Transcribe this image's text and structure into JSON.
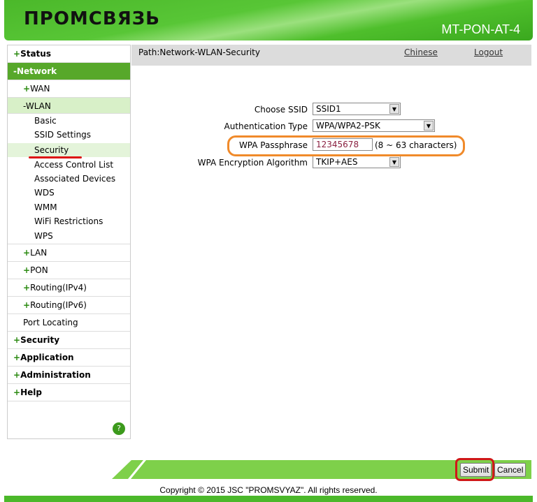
{
  "header": {
    "logo": "ПРОМСВЯЗЬ",
    "model": "MT-PON-AT-4"
  },
  "path": {
    "text": "Path:Network-WLAN-Security",
    "chinese": "Chinese",
    "logout": "Logout"
  },
  "sidebar": {
    "status": "Status",
    "network": "-Network",
    "wan": "WAN",
    "wlan": "-WLAN",
    "wlan_items": [
      "Basic",
      "SSID Settings",
      "Security",
      "Access Control List",
      "Associated Devices",
      "WDS",
      "WMM",
      "WiFi Restrictions",
      "WPS"
    ],
    "lan": "LAN",
    "pon": "PON",
    "routing4": "Routing(IPv4)",
    "routing6": "Routing(IPv6)",
    "port": "Port Locating",
    "security": "Security",
    "application": "Application",
    "administration": "Administration",
    "help": "Help",
    "plus": "+",
    "help_icon": "?"
  },
  "form": {
    "ssid_label": "Choose SSID",
    "ssid_value": "SSID1",
    "auth_label": "Authentication Type",
    "auth_value": "WPA/WPA2-PSK",
    "pass_label": "WPA Passphrase",
    "pass_value": "12345678",
    "pass_hint": "(8 ~ 63 characters)",
    "enc_label": "WPA Encryption Algorithm",
    "enc_value": "TKIP+AES"
  },
  "buttons": {
    "submit": "Submit",
    "cancel": "Cancel"
  },
  "footer": {
    "copyright": "Copyright © 2015 JSC \"PROMSVYAZ\". All rights reserved."
  },
  "colors": {
    "brand_green": "#4bb82a",
    "highlight_orange": "#f08a2a",
    "highlight_red": "#d01818"
  }
}
